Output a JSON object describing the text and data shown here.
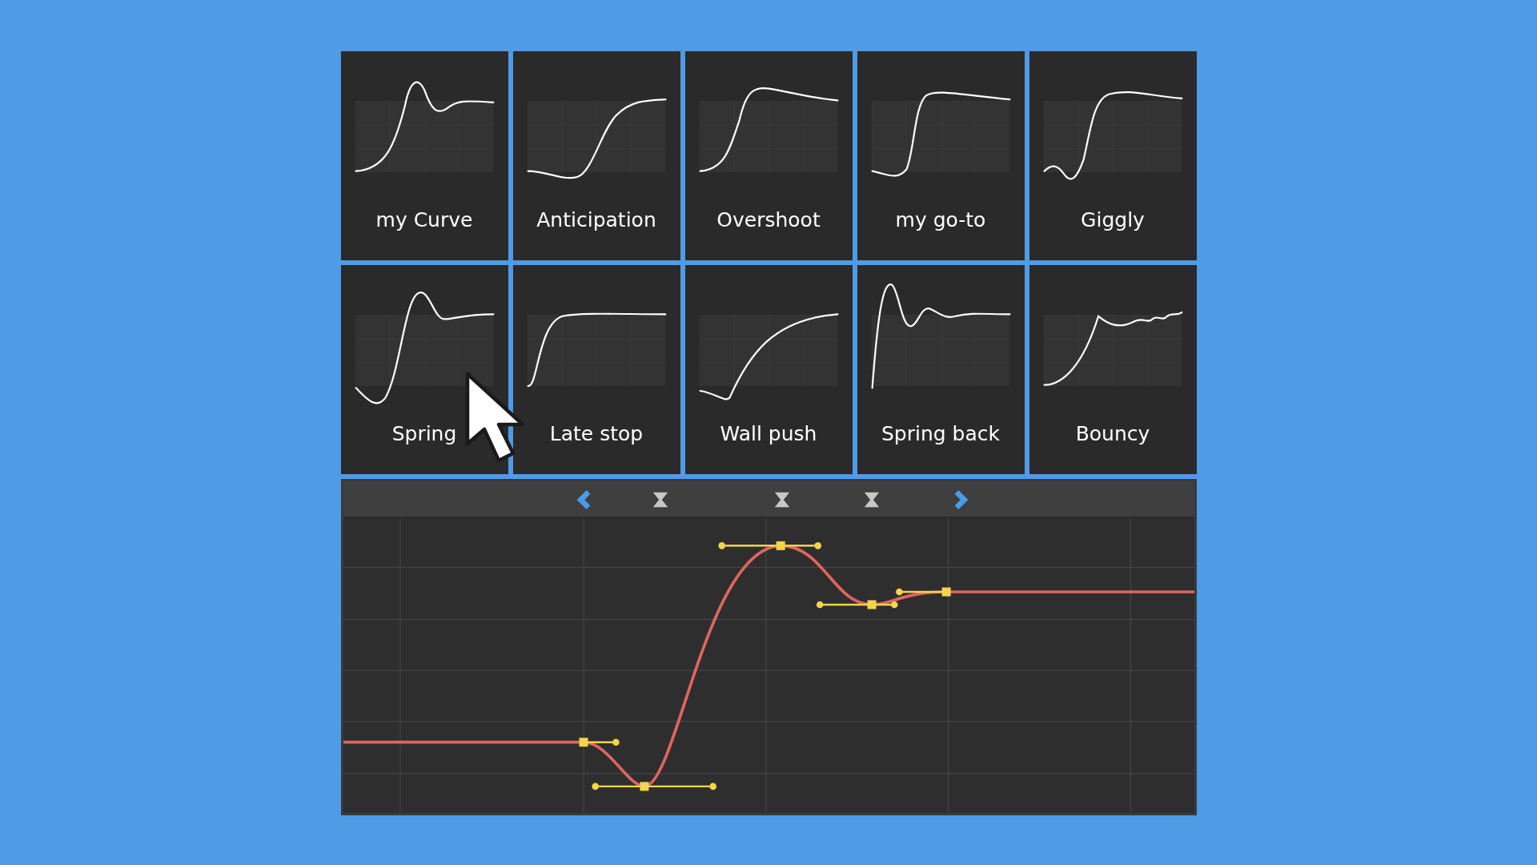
{
  "presets": [
    {
      "label": "my Curve"
    },
    {
      "label": "Anticipation"
    },
    {
      "label": "Overshoot"
    },
    {
      "label": "my go-to"
    },
    {
      "label": "Giggly"
    },
    {
      "label": "Spring"
    },
    {
      "label": "Late stop"
    },
    {
      "label": "Wall push"
    },
    {
      "label": "Spring back"
    },
    {
      "label": "Bouncy"
    }
  ]
}
